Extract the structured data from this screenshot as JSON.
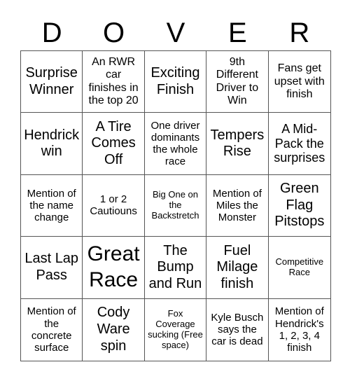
{
  "title_letters": [
    "D",
    "O",
    "V",
    "E",
    "R"
  ],
  "cells": [
    "Surprise Winner",
    "An RWR car finishes in the top 20",
    "Exciting Finish",
    "9th Different Driver to Win",
    "Fans get upset with finish",
    "Hendrick win",
    "A Tire Comes Off",
    "One driver dominants the whole race",
    "Tempers Rise",
    "A Mid-Pack the surprises",
    "Mention of the name change",
    "1 or 2 Cautiouns",
    "Big One on the Backstretch",
    "Mention of Miles the Monster",
    "Green Flag Pitstops",
    "Last Lap Pass",
    "Great Race",
    "The Bump and Run",
    "Fuel Milage finish",
    "Competitive Race",
    "Mention of the concrete surface",
    "Cody Ware spin",
    "Fox Coverage sucking (Free space)",
    "Kyle Busch says the car is dead",
    "Mention of Hendrick's 1, 2, 3, 4 finish"
  ]
}
